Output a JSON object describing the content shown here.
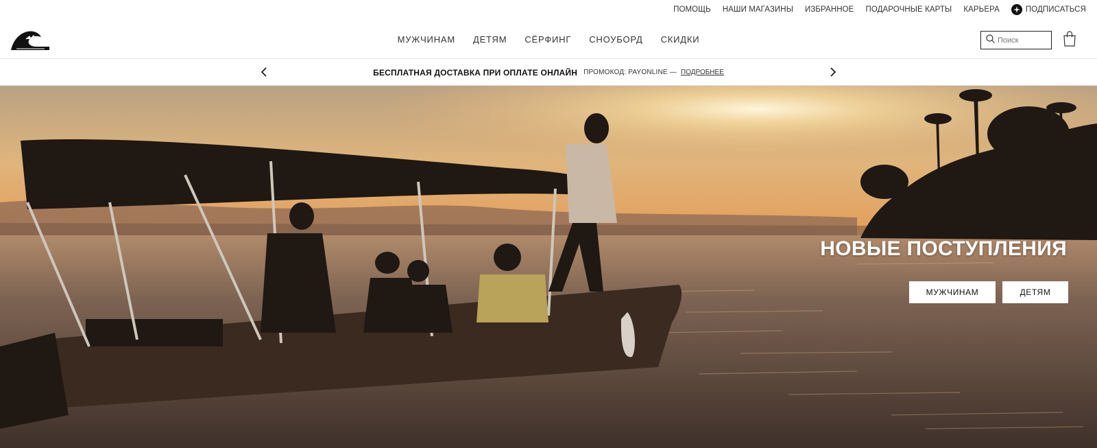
{
  "utility_nav": {
    "items": [
      "ПОМОЩЬ",
      "НАШИ МАГАЗИНЫ",
      "ИЗБРАННОЕ",
      "ПОДАРОЧНЫЕ КАРТЫ",
      "КАРЬЕРА"
    ],
    "subscribe_label": "ПОДПИСАТЬСЯ",
    "subscribe_icon": "subscribe-icon"
  },
  "header": {
    "logo_icon": "quiksilver-logo",
    "nav": [
      "МУЖЧИНАМ",
      "ДЕТЯМ",
      "СЁРФИНГ",
      "СНОУБОРД",
      "СКИДКИ"
    ],
    "search": {
      "placeholder": "Поиск",
      "value": "",
      "icon": "search-icon"
    },
    "bag_icon": "shopping-bag-icon"
  },
  "promo": {
    "headline": "БЕСПЛАТНАЯ ДОСТАВКА ПРИ ОПЛАТЕ ОНЛАЙН",
    "code_text": "ПРОМОКОД: PAYONLINE —",
    "link_label": "ПОДРОБНЕЕ",
    "prev_icon": "chevron-left-icon",
    "next_icon": "chevron-right-icon"
  },
  "hero": {
    "title": "НОВЫЕ ПОСТУПЛЕНИЯ",
    "buttons": [
      "МУЖЧИНАМ",
      "ДЕТЯМ"
    ],
    "image": "sunset-boat-photo"
  },
  "colors": {
    "text": "#222222",
    "divider": "#e3e3e3",
    "sky_top": "#c9b28e",
    "sky_glow": "#f2c98a",
    "water": "#6b5546",
    "silhouette": "#1f1813"
  }
}
